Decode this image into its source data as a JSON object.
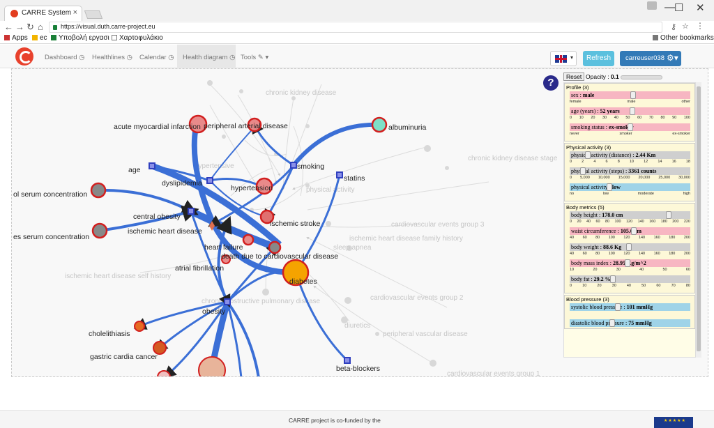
{
  "browser": {
    "tab_title": "CARRE System",
    "tab_close": "×",
    "url": "https://visual.duth.carre-project.eu",
    "window_controls": {
      "minimize": "—",
      "maximize": "☐",
      "close": "✕"
    },
    "nav_icons": [
      "back-icon",
      "forward-icon",
      "reload-icon",
      "home-icon"
    ],
    "bookmarks": [
      {
        "label": "Apps",
        "icon": "apps-icon"
      },
      {
        "label": "ec",
        "icon": "bookmark-icon"
      },
      {
        "label": "Υποβολή εργασι",
        "icon": "bookmark-icon"
      },
      {
        "label": "Χαρτοφυλάκιο",
        "icon": "page-icon"
      }
    ],
    "other_bookmarks": "Other bookmarks"
  },
  "nav": {
    "items": [
      {
        "label": "Dashboard",
        "icon": "clock-icon"
      },
      {
        "label": "Healthlines",
        "icon": "clock-icon"
      },
      {
        "label": "Calendar",
        "icon": "clock-icon"
      },
      {
        "label": "Health diagram",
        "icon": "clock-icon",
        "active": true
      },
      {
        "label": "Tools",
        "icon": "wrench-icon"
      }
    ],
    "refresh": "Refresh",
    "user": "carreuser038"
  },
  "diagram": {
    "nodes": [
      {
        "label": "acute myocardial infarction"
      },
      {
        "label": "peripheral arterial disease"
      },
      {
        "label": "albuminuria"
      },
      {
        "label": "age"
      },
      {
        "label": "dyslipidemia"
      },
      {
        "label": "smoking"
      },
      {
        "label": "statins"
      },
      {
        "label": "hypertension"
      },
      {
        "label": "central obesity"
      },
      {
        "label": "ol serum concentration"
      },
      {
        "label": "es serum concentration"
      },
      {
        "label": "ischemic heart disease"
      },
      {
        "label": "ischemic stroke"
      },
      {
        "label": "heart failure"
      },
      {
        "label": "death due to cardiovascular disease"
      },
      {
        "label": "atrial fibrillation"
      },
      {
        "label": "diabetes"
      },
      {
        "label": "obesity"
      },
      {
        "label": "cholelithiasis"
      },
      {
        "label": "gastric cardia cancer"
      },
      {
        "label": "beta-blockers"
      }
    ],
    "faded_labels": [
      "chronic kidney disease",
      "chronic kidney disease stage",
      "hypertensive",
      "physical activity",
      "cardiovascular events group 3",
      "ischemic heart disease family history",
      "sleep apnea",
      "ischemic heart disease self history",
      "cardiovascular events group 2",
      "chronic obstructive pulmonary disease",
      "diuretics",
      "peripheral vascular disease",
      "cardiovascular events group 1"
    ]
  },
  "controls": {
    "reset": "Reset",
    "opacity_label": "Opacity",
    "opacity_value": "0.1",
    "help": "?"
  },
  "panel": {
    "groups": [
      {
        "title": "Profile (3)",
        "rows": [
          {
            "label": "sex",
            "value": "male",
            "color": "pink",
            "level": 0.5,
            "ticks": [
              "female",
              "male",
              "other"
            ]
          },
          {
            "label": "age (years)",
            "value": "52 years",
            "color": "pink",
            "level": 0.52,
            "ticks": [
              "0",
              "10",
              "20",
              "30",
              "40",
              "50",
              "60",
              "70",
              "80",
              "90",
              "100"
            ]
          },
          {
            "label": "smoking status",
            "value": "ex-smoker",
            "color": "pink",
            "level": 0.5,
            "ticks": [
              "never",
              "smoker",
              "ex-smoker"
            ]
          }
        ]
      },
      {
        "title": "Physical activity (3)",
        "rows": [
          {
            "label": "physical activity (distance)",
            "value": "2.44 Km",
            "color": "gray",
            "level": 0.15,
            "ticks": [
              "0",
              "2",
              "4",
              "6",
              "8",
              "10",
              "12",
              "14",
              "16",
              "18"
            ]
          },
          {
            "label": "physical activity (steps)",
            "value": "3361 counts",
            "color": "gray",
            "level": 0.11,
            "ticks": [
              "0",
              "5,000",
              "10,000",
              "15,000",
              "20,000",
              "25,000",
              "30,000"
            ]
          },
          {
            "label": "physical activity",
            "value": "low",
            "color": "blue",
            "level": 0.33,
            "ticks": [
              "no",
              "low",
              "moderate",
              "high"
            ]
          }
        ]
      },
      {
        "title": "Body metrics (5)",
        "rows": [
          {
            "label": "body height",
            "value": "178.0 cm",
            "color": "gray",
            "level": 0.82,
            "ticks": [
              "0",
              "20",
              "40",
              "60",
              "80",
              "100",
              "120",
              "140",
              "160",
              "180",
              "200",
              "220"
            ]
          },
          {
            "label": "waist circumference",
            "value": "105.0 cm",
            "color": "pink",
            "level": 0.53,
            "ticks": [
              "40",
              "60",
              "80",
              "100",
              "120",
              "140",
              "160",
              "180",
              "200"
            ]
          },
          {
            "label": "body weight",
            "value": "88.6 Kg",
            "color": "gray",
            "level": 0.49,
            "ticks": [
              "40",
              "60",
              "80",
              "100",
              "120",
              "140",
              "160",
              "180",
              "200"
            ]
          },
          {
            "label": "body mass index",
            "value": "28.95 Kg/m^2",
            "color": "pink",
            "level": 0.48,
            "ticks": [
              "10",
              "20",
              "30",
              "40",
              "50",
              "60"
            ]
          },
          {
            "label": "body fat",
            "value": "29.2 %",
            "color": "gray",
            "level": 0.36,
            "ticks": [
              "0",
              "10",
              "20",
              "30",
              "40",
              "50",
              "60",
              "70",
              "80"
            ]
          }
        ]
      },
      {
        "title": "Blood pressure (3)",
        "rows": [
          {
            "label": "systolic blood pressure",
            "value": "101 mmHg",
            "color": "blue",
            "level": 0.4,
            "ticks": []
          },
          {
            "label": "diastolic blood pressure",
            "value": "75 mmHg",
            "color": "blue",
            "level": 0.35,
            "ticks": []
          }
        ]
      }
    ]
  },
  "footer": {
    "text": "CARRE project is co-funded by the"
  },
  "colors": {
    "edge": "#3b6fd6",
    "node_fill": "#e88a8a",
    "node_stroke": "#d21f1f",
    "diabetes_fill": "#f5a300",
    "square": "#2f3fbf",
    "faded": "#b9b9b9"
  }
}
